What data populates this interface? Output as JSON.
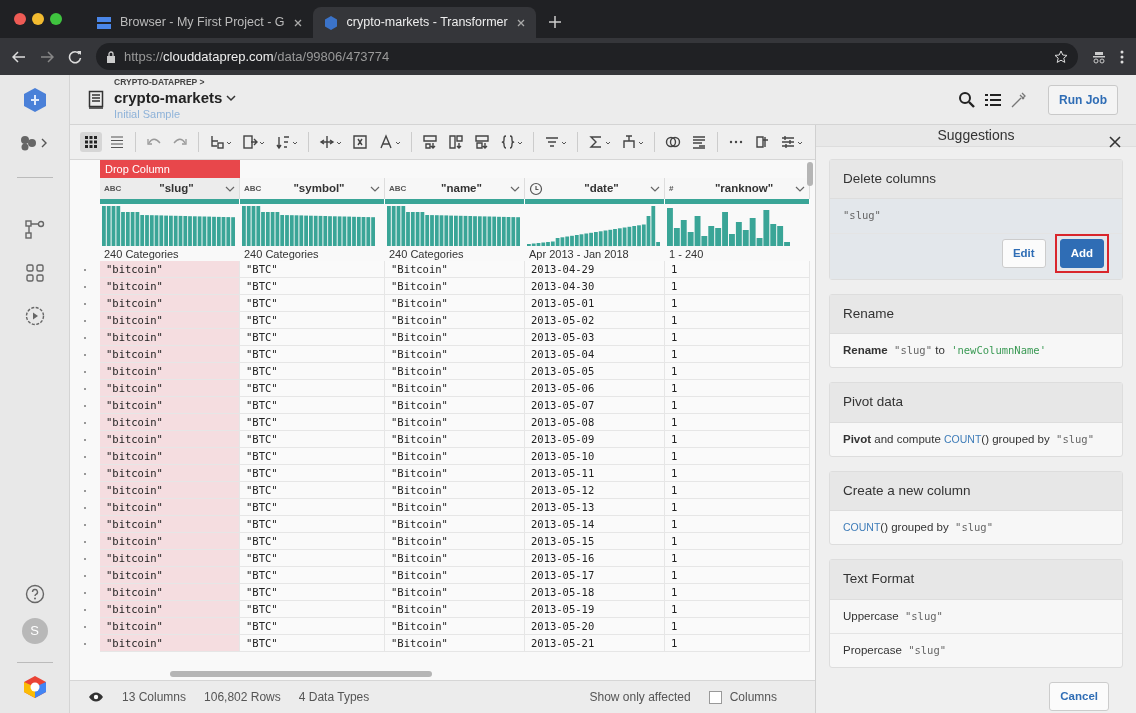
{
  "browser": {
    "tabs": [
      {
        "title": "Browser - My First Project - G",
        "kind": "storage",
        "selected": false
      },
      {
        "title": "crypto-markets - Transformer",
        "kind": "dataprep",
        "selected": true
      }
    ],
    "url": {
      "scheme": "https://",
      "host": "clouddataprep.com",
      "path": "/data/99806/473774"
    }
  },
  "app": {
    "breadcrumb": "CRYPTO-DATAPREP >",
    "title": "crypto-markets",
    "subtitle": "Initial Sample",
    "run_button": "Run Job",
    "avatar": "S"
  },
  "toolbar": {
    "view_modes": [
      {
        "kind": "grid",
        "selected": true
      },
      {
        "kind": "list",
        "selected": false
      }
    ]
  },
  "grid": {
    "drop_label": "Drop Column",
    "columns": [
      {
        "name": "\"slug\"",
        "kind": "string",
        "type_label": "ABC",
        "summary": "240 Categories",
        "selected": true
      },
      {
        "name": "\"symbol\"",
        "kind": "string",
        "type_label": "ABC",
        "summary": "240 Categories",
        "selected": false
      },
      {
        "name": "\"name\"",
        "kind": "string",
        "type_label": "ABC",
        "summary": "240 Categories",
        "selected": false
      },
      {
        "name": "\"date\"",
        "kind": "datetime",
        "summary": "Apr 2013 - Jan 2018",
        "selected": false
      },
      {
        "name": "\"ranknow\"",
        "kind": "integer",
        "type_label": "#",
        "summary": "1 - 240",
        "selected": false
      }
    ],
    "rows": [
      [
        "\"bitcoin\"",
        "\"BTC\"",
        "\"Bitcoin\"",
        "2013-04-29",
        "1"
      ],
      [
        "\"bitcoin\"",
        "\"BTC\"",
        "\"Bitcoin\"",
        "2013-04-30",
        "1"
      ],
      [
        "\"bitcoin\"",
        "\"BTC\"",
        "\"Bitcoin\"",
        "2013-05-01",
        "1"
      ],
      [
        "\"bitcoin\"",
        "\"BTC\"",
        "\"Bitcoin\"",
        "2013-05-02",
        "1"
      ],
      [
        "\"bitcoin\"",
        "\"BTC\"",
        "\"Bitcoin\"",
        "2013-05-03",
        "1"
      ],
      [
        "\"bitcoin\"",
        "\"BTC\"",
        "\"Bitcoin\"",
        "2013-05-04",
        "1"
      ],
      [
        "\"bitcoin\"",
        "\"BTC\"",
        "\"Bitcoin\"",
        "2013-05-05",
        "1"
      ],
      [
        "\"bitcoin\"",
        "\"BTC\"",
        "\"Bitcoin\"",
        "2013-05-06",
        "1"
      ],
      [
        "\"bitcoin\"",
        "\"BTC\"",
        "\"Bitcoin\"",
        "2013-05-07",
        "1"
      ],
      [
        "\"bitcoin\"",
        "\"BTC\"",
        "\"Bitcoin\"",
        "2013-05-08",
        "1"
      ],
      [
        "\"bitcoin\"",
        "\"BTC\"",
        "\"Bitcoin\"",
        "2013-05-09",
        "1"
      ],
      [
        "\"bitcoin\"",
        "\"BTC\"",
        "\"Bitcoin\"",
        "2013-05-10",
        "1"
      ],
      [
        "\"bitcoin\"",
        "\"BTC\"",
        "\"Bitcoin\"",
        "2013-05-11",
        "1"
      ],
      [
        "\"bitcoin\"",
        "\"BTC\"",
        "\"Bitcoin\"",
        "2013-05-12",
        "1"
      ],
      [
        "\"bitcoin\"",
        "\"BTC\"",
        "\"Bitcoin\"",
        "2013-05-13",
        "1"
      ],
      [
        "\"bitcoin\"",
        "\"BTC\"",
        "\"Bitcoin\"",
        "2013-05-14",
        "1"
      ],
      [
        "\"bitcoin\"",
        "\"BTC\"",
        "\"Bitcoin\"",
        "2013-05-15",
        "1"
      ],
      [
        "\"bitcoin\"",
        "\"BTC\"",
        "\"Bitcoin\"",
        "2013-05-16",
        "1"
      ],
      [
        "\"bitcoin\"",
        "\"BTC\"",
        "\"Bitcoin\"",
        "2013-05-17",
        "1"
      ],
      [
        "\"bitcoin\"",
        "\"BTC\"",
        "\"Bitcoin\"",
        "2013-05-18",
        "1"
      ],
      [
        "\"bitcoin\"",
        "\"BTC\"",
        "\"Bitcoin\"",
        "2013-05-19",
        "1"
      ],
      [
        "\"bitcoin\"",
        "\"BTC\"",
        "\"Bitcoin\"",
        "2013-05-20",
        "1"
      ],
      [
        "\"bitcoin\"",
        "\"BTC\"",
        "\"Bitcoin\"",
        "2013-05-21",
        "1"
      ]
    ]
  },
  "footer": {
    "columns": "13 Columns",
    "rows": "106,802 Rows",
    "types": "4 Data Types",
    "filter_label": "Show only affected",
    "filter_checked": false,
    "filter_option": "Columns"
  },
  "suggestions": {
    "title": "Suggestions",
    "cancel": "Cancel",
    "cards": [
      {
        "title": "Delete columns",
        "selected": true,
        "items": [
          {
            "parts": [
              {
                "text": "\"slug\"",
                "kind": "code"
              }
            ]
          }
        ],
        "buttons": [
          {
            "label": "Edit",
            "primary": false,
            "highlighted": false
          },
          {
            "label": "Add",
            "primary": true,
            "highlighted": true
          }
        ]
      },
      {
        "title": "Rename",
        "selected": false,
        "items": [
          {
            "parts": [
              {
                "text": "Rename",
                "kind": "keyword"
              },
              {
                "text": " \"slug\"",
                "kind": "code"
              },
              {
                "text": " to",
                "kind": "plain"
              },
              {
                "text": " 'newColumnName'",
                "kind": "string"
              }
            ]
          }
        ]
      },
      {
        "title": "Pivot data",
        "selected": false,
        "items": [
          {
            "parts": [
              {
                "text": "Pivot",
                "kind": "keyword"
              },
              {
                "text": " and compute ",
                "kind": "plain"
              },
              {
                "text": "COUNT",
                "kind": "function"
              },
              {
                "text": "() grouped by",
                "kind": "plain"
              },
              {
                "text": " \"slug\"",
                "kind": "code"
              }
            ]
          }
        ]
      },
      {
        "title": "Create a new column",
        "selected": false,
        "items": [
          {
            "parts": [
              {
                "text": "COUNT",
                "kind": "function"
              },
              {
                "text": "() grouped by",
                "kind": "plain"
              },
              {
                "text": " \"slug\"",
                "kind": "code"
              }
            ]
          }
        ]
      },
      {
        "title": "Text Format",
        "selected": false,
        "items": [
          {
            "parts": [
              {
                "text": "Uppercase",
                "kind": "plain"
              },
              {
                "text": " \"slug\"",
                "kind": "code"
              }
            ]
          },
          {
            "parts": [
              {
                "text": "Propercase",
                "kind": "plain"
              },
              {
                "text": " \"slug\"",
                "kind": "code"
              }
            ]
          }
        ]
      }
    ]
  }
}
